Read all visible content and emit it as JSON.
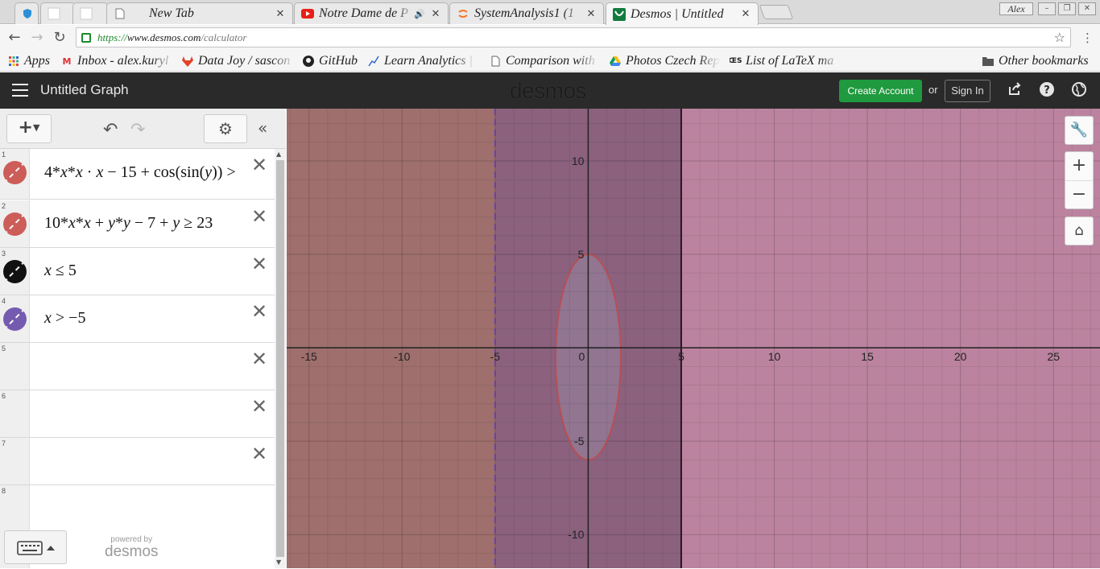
{
  "browser": {
    "tabs": [
      {
        "title": "",
        "icon": "shield-icon"
      },
      {
        "title": "",
        "icon": "blank-page-icon"
      },
      {
        "title": "",
        "icon": "blank-page-icon"
      },
      {
        "title": "New Tab",
        "icon": "page-icon"
      },
      {
        "title": "Notre Dame de P",
        "icon": "youtube-icon",
        "audio": "🔊"
      },
      {
        "title": "SystemAnalysis1 (1",
        "icon": "jupyter-icon"
      },
      {
        "title": "Desmos | Untitled",
        "icon": "desmos-icon",
        "active": true
      }
    ],
    "profile_name": "Alex",
    "url_scheme": "https://",
    "url_host": "www.desmos.com",
    "url_path": "/calculator",
    "bookmarks": [
      {
        "label": "Apps",
        "icon": "apps-grid-icon"
      },
      {
        "label": "Inbox - alex.kuryl",
        "icon": "gmail-icon"
      },
      {
        "label": "Data Joy / sascon",
        "icon": "gitlab-icon"
      },
      {
        "label": "GitHub",
        "icon": "github-icon"
      },
      {
        "label": "Learn Analytics |",
        "icon": "analytics-icon"
      },
      {
        "label": "Comparison with",
        "icon": "page-icon"
      },
      {
        "label": "Photos Czech Rep",
        "icon": "google-drive-icon"
      },
      {
        "label": "List of LaTeX ma",
        "icon": "latex-icon"
      },
      {
        "label": "Other bookmarks",
        "icon": "folder-icon"
      }
    ]
  },
  "desmos": {
    "graph_title": "Untitled Graph",
    "logo": "desmos",
    "create_account": "Create Account",
    "or": "or",
    "sign_in": "Sign In",
    "powered_by": "powered by",
    "powered_brand": "desmos",
    "expressions": [
      {
        "num": "1",
        "color": "#c74440",
        "has_text": true
      },
      {
        "num": "2",
        "color": "#c74440",
        "has_text": true
      },
      {
        "num": "3",
        "color": "#000000",
        "has_text": true
      },
      {
        "num": "4",
        "color": "#6042a6",
        "has_text": true
      },
      {
        "num": "5",
        "has_text": false
      },
      {
        "num": "6",
        "has_text": false
      },
      {
        "num": "7",
        "has_text": false
      },
      {
        "num": "8",
        "has_text": false
      }
    ]
  },
  "chart_data": {
    "type": "region-plot",
    "xlim": [
      -16.2,
      27.5
    ],
    "ylim": [
      -11.8,
      12.8
    ],
    "grid": true,
    "x_tick_labels": [
      "-15",
      "-10",
      "-5",
      "0",
      "5",
      "10",
      "15",
      "20",
      "25"
    ],
    "y_tick_labels": [
      "10",
      "5",
      "-5",
      "-10"
    ],
    "regions": [
      {
        "expr": "x ≤ 5",
        "color": "#000000",
        "xmax": 5,
        "boundary": "solid"
      },
      {
        "expr": "x > -5",
        "color": "#6042a6",
        "xmin": -5,
        "boundary": "dashed"
      },
      {
        "expr": "10*x*x + y*y - 7 + y ≥ 23",
        "color": "#c74440",
        "ellipse_center": [
          0,
          -0.5
        ],
        "ellipse_rx": 1.75,
        "ellipse_ry": 5.5,
        "shaded": "outside"
      },
      {
        "expr": "4*x*x·x - 15 + cos(sin(y)) >",
        "color": "#c74440",
        "shaded": "right"
      }
    ]
  }
}
